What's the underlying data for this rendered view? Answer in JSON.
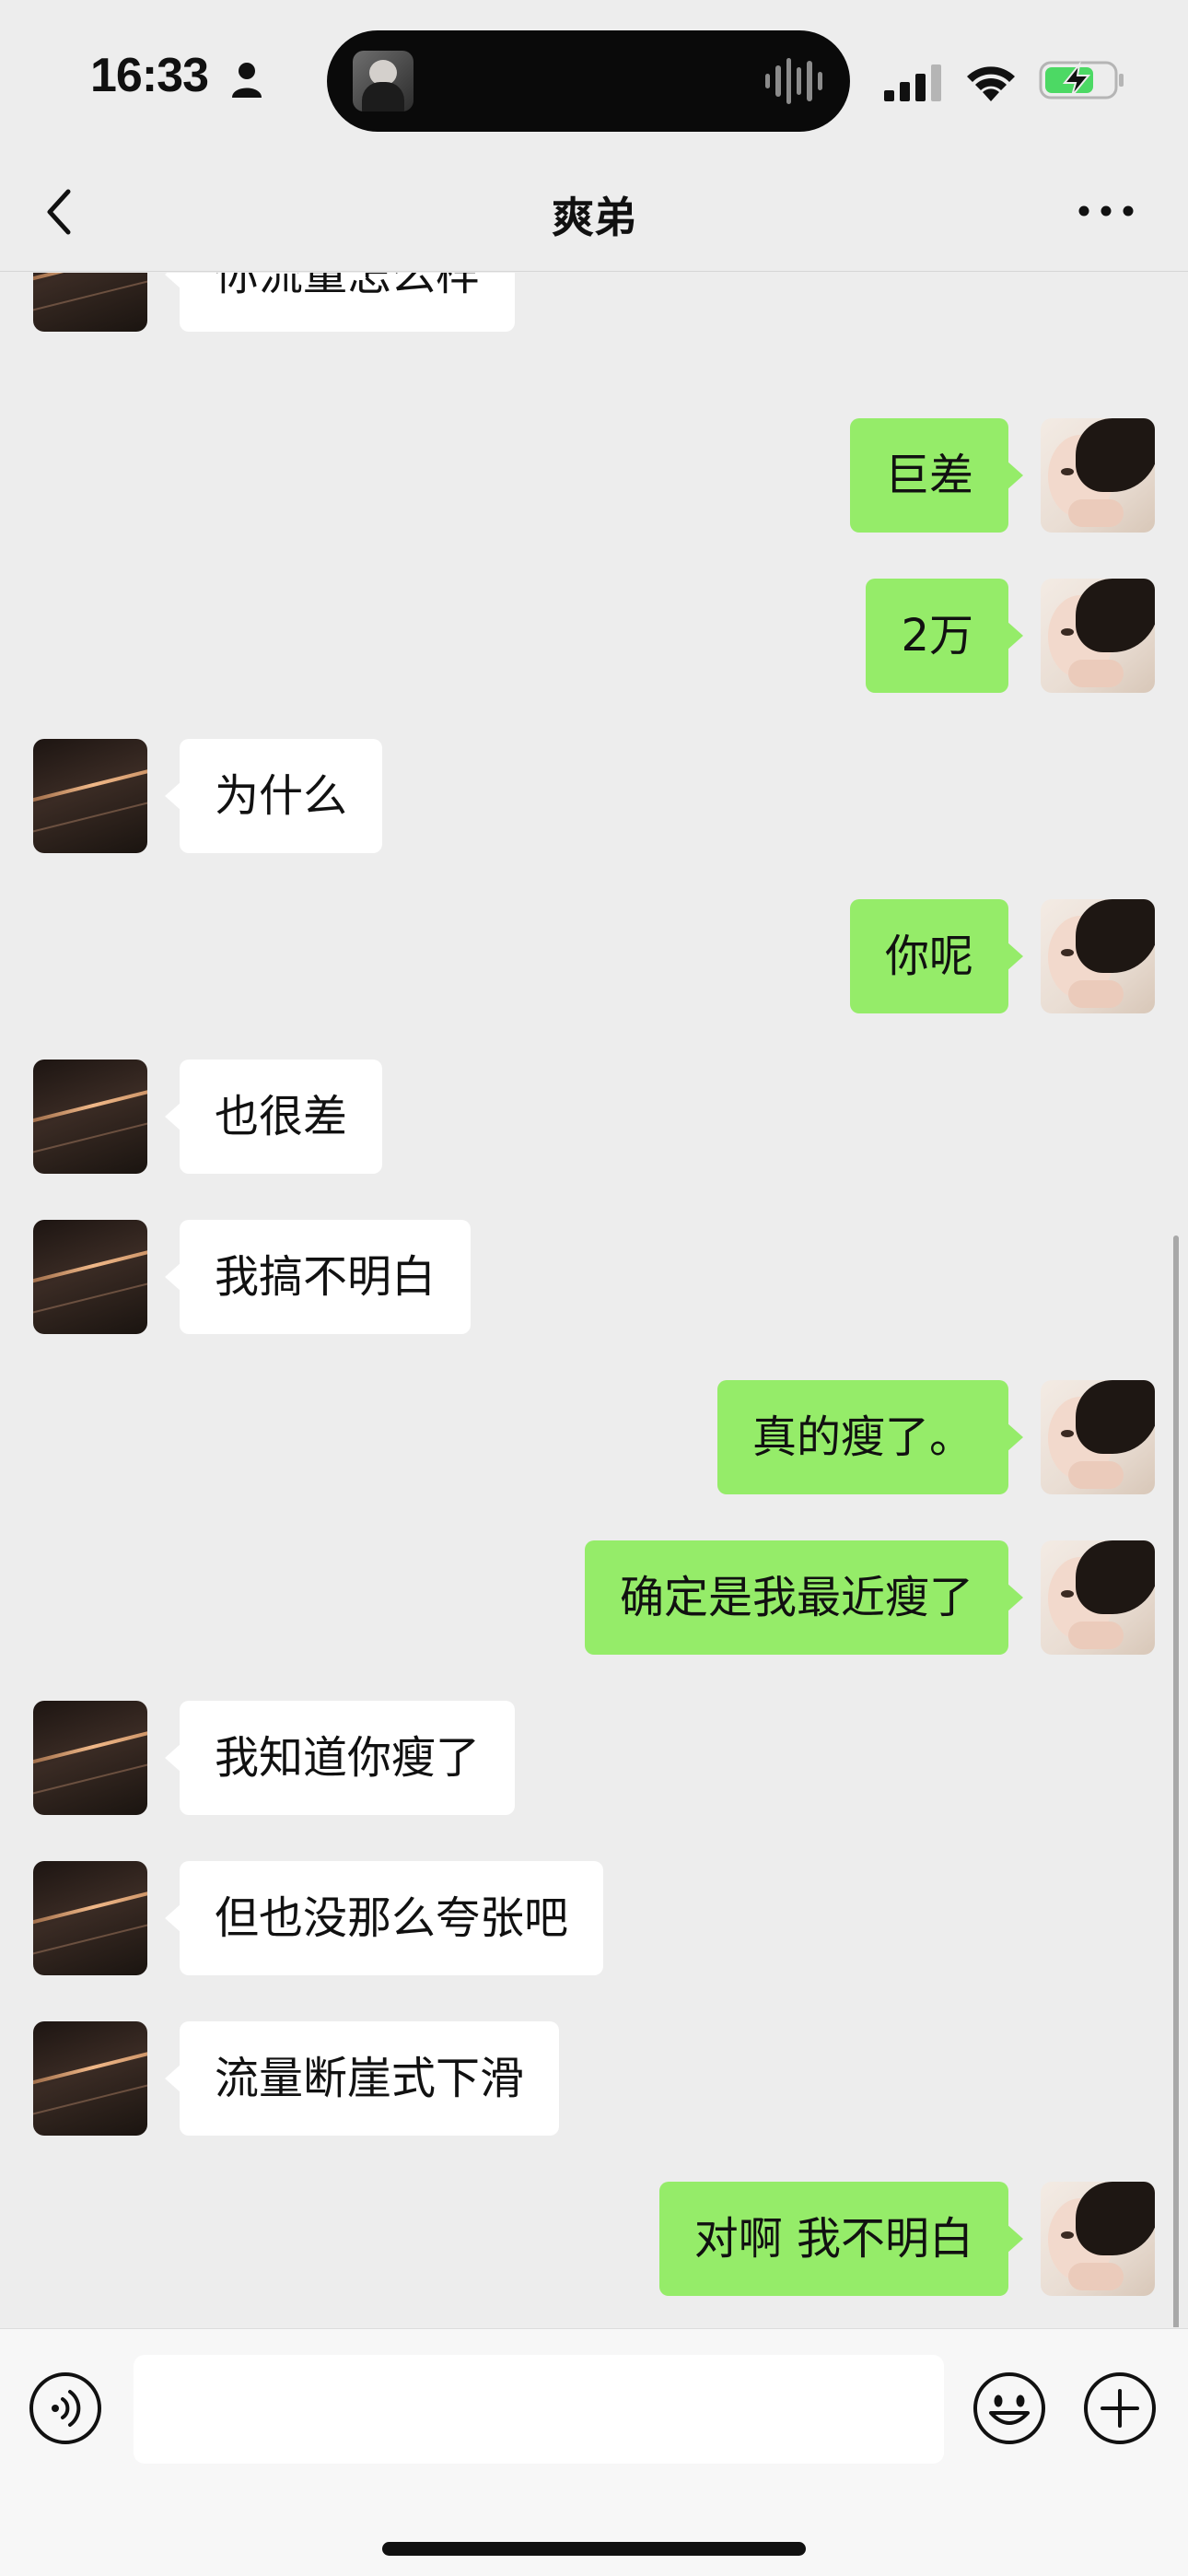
{
  "status_bar": {
    "time": "16:33",
    "icons": [
      "person-icon",
      "album-art",
      "waveform-icon",
      "signal-icon",
      "wifi-icon",
      "battery-charging-icon"
    ]
  },
  "nav": {
    "title": "爽弟",
    "back_icon": "chevron-left-icon",
    "more_icon": "more-dots-icon"
  },
  "colors": {
    "background": "#ededed",
    "bubble_self": "#95ec69",
    "bubble_other": "#ffffff",
    "input_bar": "#f7f7f7"
  },
  "messages": [
    {
      "side": "left",
      "text": "你流量怎么样"
    },
    {
      "side": "right",
      "text": "巨差"
    },
    {
      "side": "right",
      "text": "2万"
    },
    {
      "side": "left",
      "text": "为什么"
    },
    {
      "side": "right",
      "text": "你呢"
    },
    {
      "side": "left",
      "text": "也很差"
    },
    {
      "side": "left",
      "text": "我搞不明白"
    },
    {
      "side": "right",
      "text": "真的瘦了。"
    },
    {
      "side": "right",
      "text": "确定是我最近瘦了"
    },
    {
      "side": "left",
      "text": "我知道你瘦了"
    },
    {
      "side": "left",
      "text": "但也没那么夸张吧"
    },
    {
      "side": "left",
      "text": "流量断崖式下滑"
    },
    {
      "side": "right",
      "text": "对啊 我不明白"
    }
  ],
  "input_bar": {
    "value": "",
    "placeholder": "",
    "icons": [
      "voice-icon",
      "emoji-icon",
      "plus-icon"
    ]
  }
}
